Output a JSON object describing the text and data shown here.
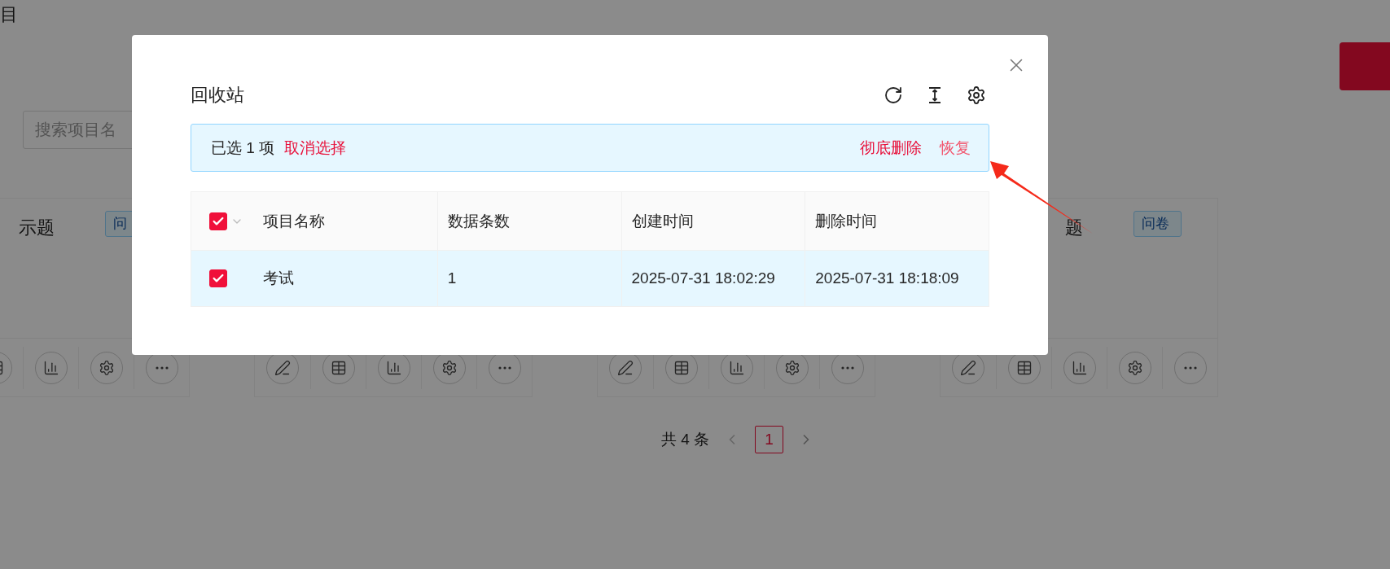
{
  "page": {
    "heading": "目",
    "search": {
      "placeholder": "搜索项目名"
    },
    "cards": [
      {
        "kind": "titled",
        "title": "示题",
        "tag": "问"
      },
      {
        "kind": "covered"
      },
      {
        "kind": "covered"
      },
      {
        "kind": "titled",
        "title": "题",
        "tag": "问卷"
      }
    ],
    "pagination": {
      "total": "共 4 条",
      "pages": [
        {
          "label": "1",
          "selected": true
        }
      ]
    }
  },
  "dialog": {
    "title": "回收站",
    "selection_bar": {
      "count_text": "已选 1 项",
      "clear": "取消选择",
      "actions": [
        {
          "label": "彻底删除",
          "kind": "delete"
        },
        {
          "label": "恢复",
          "kind": "restore"
        }
      ]
    },
    "table": {
      "header_checked": true,
      "columns": [
        "项目名称",
        "数据条数",
        "创建时间",
        "删除时间"
      ],
      "rows": [
        {
          "checked": true,
          "selected": true,
          "cells": [
            "考试",
            "1",
            "2025-07-31 18:02:29",
            "2025-07-31 18:18:09"
          ]
        }
      ]
    }
  }
}
